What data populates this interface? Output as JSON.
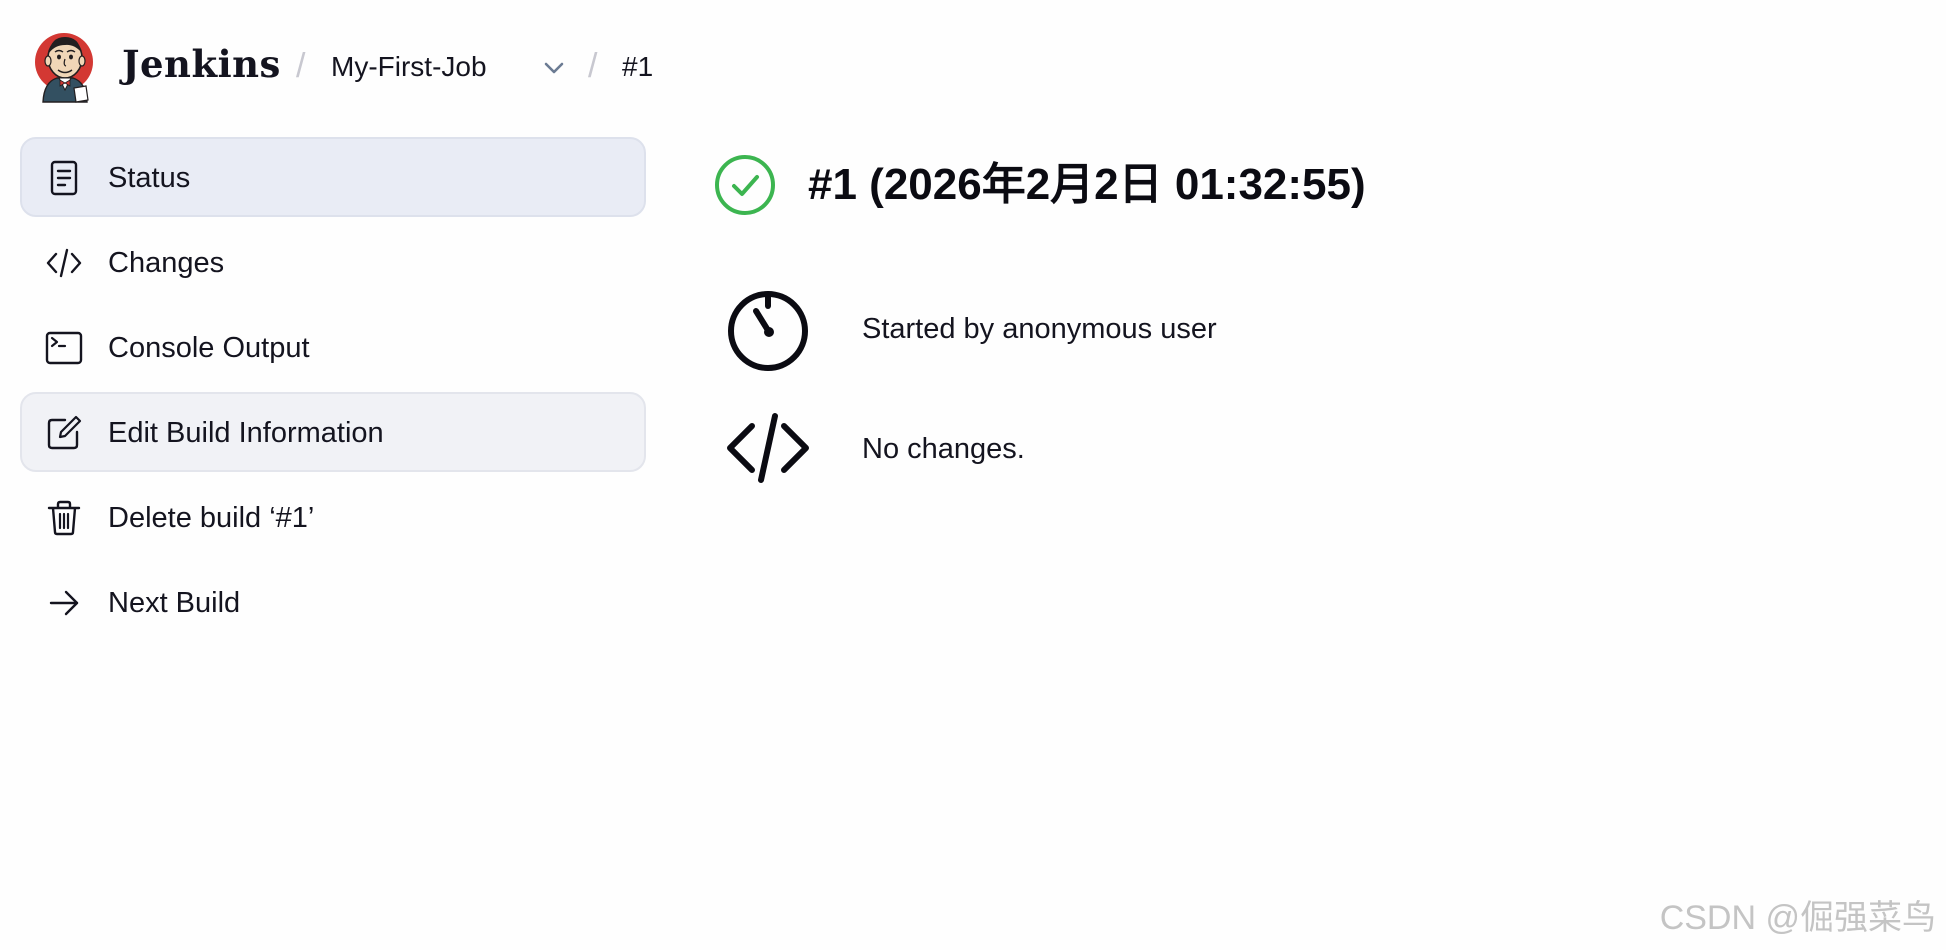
{
  "header": {
    "brand": "Jenkins",
    "separator": "/",
    "breadcrumbs": [
      {
        "label": "My-First-Job"
      },
      {
        "label": "#1"
      }
    ],
    "icons": {
      "logo": "jenkins-logo",
      "dropdown": "chevron-down-icon"
    }
  },
  "sidebar": {
    "items": [
      {
        "label": "Status",
        "icon": "document-icon",
        "state": "active"
      },
      {
        "label": "Changes",
        "icon": "code-icon",
        "state": "normal"
      },
      {
        "label": "Console Output",
        "icon": "terminal-icon",
        "state": "normal"
      },
      {
        "label": "Edit Build Information",
        "icon": "edit-icon",
        "state": "hovered"
      },
      {
        "label": "Delete build ‘#1’",
        "icon": "trash-icon",
        "state": "normal"
      },
      {
        "label": "Next Build",
        "icon": "arrow-right-icon",
        "state": "normal"
      }
    ]
  },
  "main": {
    "title": "#1 (2026年2月2日 01:32:55)",
    "status_icon": "success-check-icon",
    "rows": [
      {
        "text": "Started by anonymous user",
        "icon": "timer-icon"
      },
      {
        "text": "No changes.",
        "icon": "code-icon"
      }
    ]
  },
  "watermark": "CSDN @倔强菜鸟",
  "colors": {
    "success": "#3cb550",
    "active_bg": "#e9ecf5",
    "hover_bg": "#f1f2f6",
    "text": "#14141f",
    "separator": "#c8c8d0"
  }
}
